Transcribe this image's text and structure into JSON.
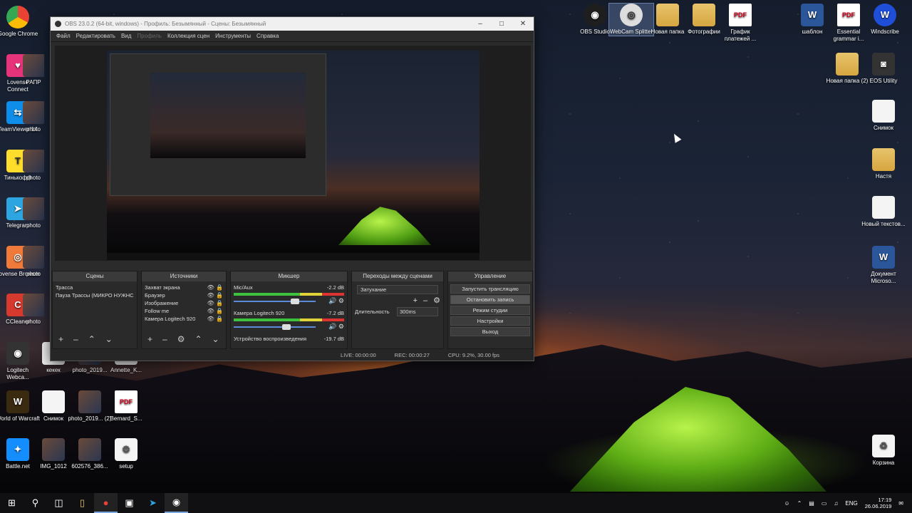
{
  "desktop": {
    "icons_left": [
      {
        "label": "Google Chrome",
        "icon": "chrome-icon",
        "style": "chrome"
      },
      {
        "label": "Lovense Connect",
        "icon": "lovense-connect-icon",
        "style": "lovense"
      },
      {
        "label": "TeamViewer 14",
        "icon": "teamviewer-icon",
        "style": "teamviewer"
      },
      {
        "label": "Тинькофф",
        "icon": "tinkoff-icon",
        "style": "tinkoff"
      },
      {
        "label": "Telegram",
        "icon": "telegram-icon",
        "style": "telegram"
      },
      {
        "label": "Lovense Browser",
        "icon": "lovense-browser-icon",
        "style": "lovense-browser"
      },
      {
        "label": "CCleaner",
        "icon": "ccleaner-icon",
        "style": "ccleaner"
      },
      {
        "label": "Logitech Webca...",
        "icon": "webcam-icon",
        "style": "logitech"
      },
      {
        "label": "World of Warcraft",
        "icon": "wow-icon",
        "style": "wow"
      },
      {
        "label": "Battle.net",
        "icon": "battlenet-icon",
        "style": "battlenet"
      }
    ],
    "icons_col2": [
      {
        "label": "РАПР",
        "icon": "folder-icon"
      },
      {
        "label": "photo",
        "icon": "photo-icon"
      },
      {
        "label": "photo",
        "icon": "photo-icon"
      },
      {
        "label": "photo",
        "icon": "photo-icon"
      },
      {
        "label": "photo",
        "icon": "photo-icon"
      },
      {
        "label": "photo",
        "icon": "photo-icon"
      }
    ],
    "icons_bottom": [
      {
        "label": "кекек",
        "icon": "file-icon"
      },
      {
        "label": "photo_2019...",
        "icon": "photo-icon"
      },
      {
        "label": "Annette_K...",
        "icon": "file-icon"
      },
      {
        "label": "Снимок",
        "icon": "image-file-icon"
      },
      {
        "label": "photo_2019... (2)",
        "icon": "photo-icon"
      },
      {
        "label": "Bernard_S...",
        "icon": "pdf-icon"
      },
      {
        "label": "IMG_1012",
        "icon": "photo-icon"
      },
      {
        "label": "602576_386...",
        "icon": "photo-icon"
      },
      {
        "label": "setup",
        "icon": "setup-icon"
      }
    ],
    "icons_top": [
      {
        "label": "OBS Studio",
        "icon": "obs-icon"
      },
      {
        "label": "WebCam Splitter",
        "icon": "webcam-splitter-icon"
      },
      {
        "label": "Новая папка",
        "icon": "folder-icon"
      },
      {
        "label": "Фотографии",
        "icon": "folder-icon"
      },
      {
        "label": "График платежей ...",
        "icon": "pdf-icon"
      },
      {
        "label": "шаблон",
        "icon": "word-icon"
      },
      {
        "label": "Essential grammar i...",
        "icon": "pdf-icon"
      },
      {
        "label": "Windscribe",
        "icon": "windscribe-icon"
      }
    ],
    "icons_right": [
      {
        "label": "Новая папка (2)",
        "icon": "folder-icon"
      },
      {
        "label": "EOS Utility",
        "icon": "camera-icon"
      },
      {
        "label": "Снимок",
        "icon": "image-file-icon"
      },
      {
        "label": "Настя",
        "icon": "folder-icon"
      },
      {
        "label": "Новый текстов...",
        "icon": "text-file-icon"
      },
      {
        "label": "Документ Microso...",
        "icon": "word-icon"
      },
      {
        "label": "Корзина",
        "icon": "recycle-bin-icon"
      }
    ]
  },
  "obs": {
    "title": "OBS 23.0.2 (64-bit, windows) - Профиль: Безымянный - Сцены: Безымянный",
    "menu": [
      "Файл",
      "Редактировать",
      "Вид",
      "Профиль",
      "Коллекция сцен",
      "Инструменты",
      "Справка"
    ],
    "menu_disabled": [
      false,
      false,
      false,
      true,
      false,
      false,
      false
    ],
    "scenes": {
      "title": "Сцены",
      "items": [
        "Трасса",
        "Пауза Трассы (МИКРО НУЖНС"
      ]
    },
    "sources": {
      "title": "Источники",
      "items": [
        "Захват экрана",
        "Браузер",
        "Изображение",
        "Follow me",
        "Камера Logitech 920"
      ]
    },
    "mixer": {
      "title": "Микшер",
      "channels": [
        {
          "name": "Mic/Aux",
          "db": "-2.2 dB",
          "level": 0.78
        },
        {
          "name": "Камера Logitech 920",
          "db": "-7.2 dB",
          "level": 0.66
        },
        {
          "name": "Устройство воспроизведения",
          "db": "-19.7 dB",
          "level": 0.3
        }
      ]
    },
    "transitions": {
      "title": "Переходы между сценами",
      "selected": "Затухание",
      "duration_label": "Длительность",
      "duration_value": "300ms"
    },
    "controls": {
      "title": "Управление",
      "buttons": [
        "Запустить трансляцию",
        "Остановить запись",
        "Режим студии",
        "Настройки",
        "Выход"
      ]
    },
    "status": {
      "live": "LIVE: 00:00:00",
      "rec": "REC: 00:00:27",
      "cpu": "CPU: 9.2%, 30.00 fps"
    }
  },
  "taskbar": {
    "lang": "ENG",
    "time": "17:19",
    "date": "26.06.2019"
  }
}
